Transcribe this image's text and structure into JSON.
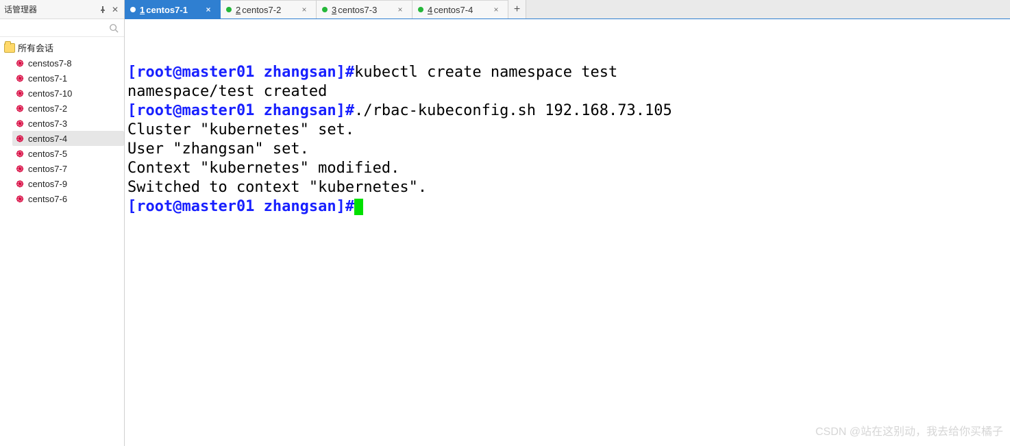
{
  "sidebar": {
    "title": "话管理器",
    "root_label": "所有会话",
    "items": [
      {
        "label": "censtos7-8"
      },
      {
        "label": "centos7-1"
      },
      {
        "label": "centos7-10"
      },
      {
        "label": "centos7-2"
      },
      {
        "label": "centos7-3"
      },
      {
        "label": "centos7-4",
        "selected": true
      },
      {
        "label": "centos7-5"
      },
      {
        "label": "centos7-7"
      },
      {
        "label": "centos7-9"
      },
      {
        "label": "centso7-6"
      }
    ]
  },
  "tabs": [
    {
      "num": "1",
      "label": "centos7-1",
      "active": true
    },
    {
      "num": "2",
      "label": "centos7-2"
    },
    {
      "num": "3",
      "label": "centos7-3"
    },
    {
      "num": "4",
      "label": "centos7-4"
    }
  ],
  "terminal": {
    "prompt": "[root@master01 zhangsan]#",
    "lines": [
      {
        "type": "cmd",
        "text": "kubectl create namespace test"
      },
      {
        "type": "out",
        "text": "namespace/test created"
      },
      {
        "type": "cmd",
        "text": "./rbac-kubeconfig.sh 192.168.73.105"
      },
      {
        "type": "out",
        "text": "Cluster \"kubernetes\" set."
      },
      {
        "type": "out",
        "text": "User \"zhangsan\" set."
      },
      {
        "type": "out",
        "text": "Context \"kubernetes\" modified."
      },
      {
        "type": "out",
        "text": "Switched to context \"kubernetes\"."
      },
      {
        "type": "cursor"
      }
    ]
  },
  "watermark": "CSDN @站在这别动，我去给你买橘子"
}
